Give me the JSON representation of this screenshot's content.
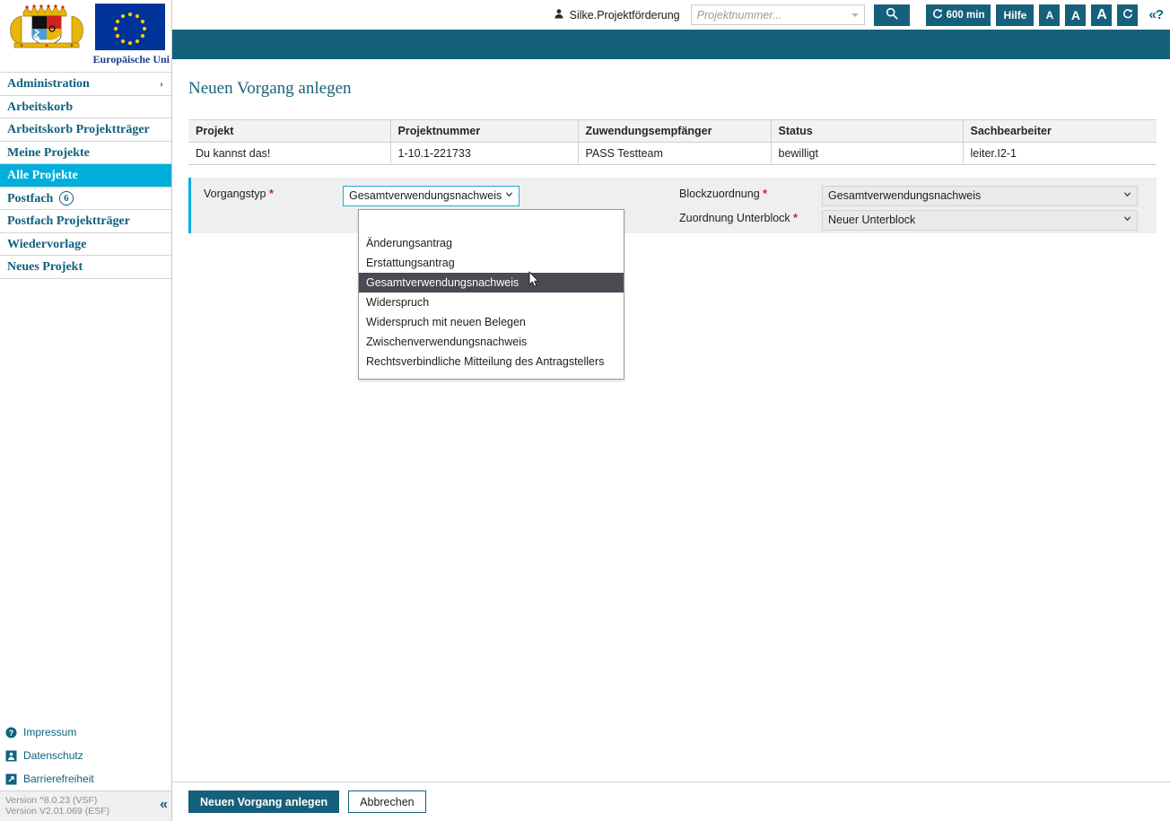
{
  "header": {
    "user_name": "Silke.Projektförderung",
    "user_icon": "user-icon",
    "search_placeholder": "Projektnummer...",
    "search_value": "",
    "search_icon": "search-icon",
    "session_timer": "600 min",
    "timer_icon": "refresh-icon",
    "help_label": "Hilfe",
    "font_small": "A",
    "font_medium": "A",
    "font_large": "A",
    "refresh_icon": "refresh-icon",
    "help_toggle": "«?",
    "accent_color": "#15607a"
  },
  "sidebar": {
    "eu_caption": "Europäische Uni",
    "items": [
      {
        "label": "Administration",
        "chevron": "›",
        "active": false
      },
      {
        "label": "Arbeitskorb",
        "active": false
      },
      {
        "label": "Arbeitskorb Projektträger",
        "active": false
      },
      {
        "label": "Meine Projekte",
        "active": false
      },
      {
        "label": "Alle Projekte",
        "active": true
      },
      {
        "label": "Postfach",
        "badge": "6",
        "active": false
      },
      {
        "label": "Postfach Projektträger",
        "active": false
      },
      {
        "label": "Wiedervorlage",
        "active": false
      },
      {
        "label": "Neues Projekt",
        "active": false
      }
    ],
    "footer_links": [
      {
        "label": "Impressum",
        "icon": "question-circle-icon"
      },
      {
        "label": "Datenschutz",
        "icon": "id-card-icon"
      },
      {
        "label": "Barrierefreiheit",
        "icon": "accessibility-arrow-icon"
      }
    ],
    "version_line1": "Version ^8.0.23 (VSF)",
    "version_line2": "Version V2.01.069 (ESF)",
    "collapse_icon": "«",
    "active_color": "#00AEDB"
  },
  "main": {
    "page_title": "Neuen Vorgang anlegen",
    "table": {
      "columns": [
        "Projekt",
        "Projektnummer",
        "Zuwendungsempfänger",
        "Status",
        "Sachbearbeiter"
      ],
      "rows": [
        [
          "Du kannst das!",
          "1-10.1-221733",
          "PASS Testteam",
          "bewilligt",
          "leiter.I2-1"
        ]
      ]
    },
    "form": {
      "vorgangstyp_label": "Vorgangstyp",
      "vorgangstyp_value": "Gesamtverwendungsnachweis",
      "blockzuordnung_label": "Blockzuordnung",
      "blockzuordnung_value": "Gesamtverwendungsnachweis",
      "unterblock_label": "Zuordnung Unterblock",
      "unterblock_value": "Neuer Unterblock",
      "required_marker": "*",
      "required_color": "#cc2222"
    },
    "dropdown": {
      "open": true,
      "highlight_color": "#4a4a52",
      "options": [
        "",
        "Änderungsantrag",
        "Erstattungsantrag",
        "Gesamtverwendungsnachweis",
        "Widerspruch",
        "Widerspruch mit neuen Belegen",
        "Zwischenverwendungsnachweis",
        "Rechtsverbindliche Mitteilung des Antragstellers"
      ],
      "selected": "Gesamtverwendungsnachweis"
    },
    "actions": {
      "submit_label": "Neuen Vorgang anlegen",
      "cancel_label": "Abbrechen"
    }
  }
}
